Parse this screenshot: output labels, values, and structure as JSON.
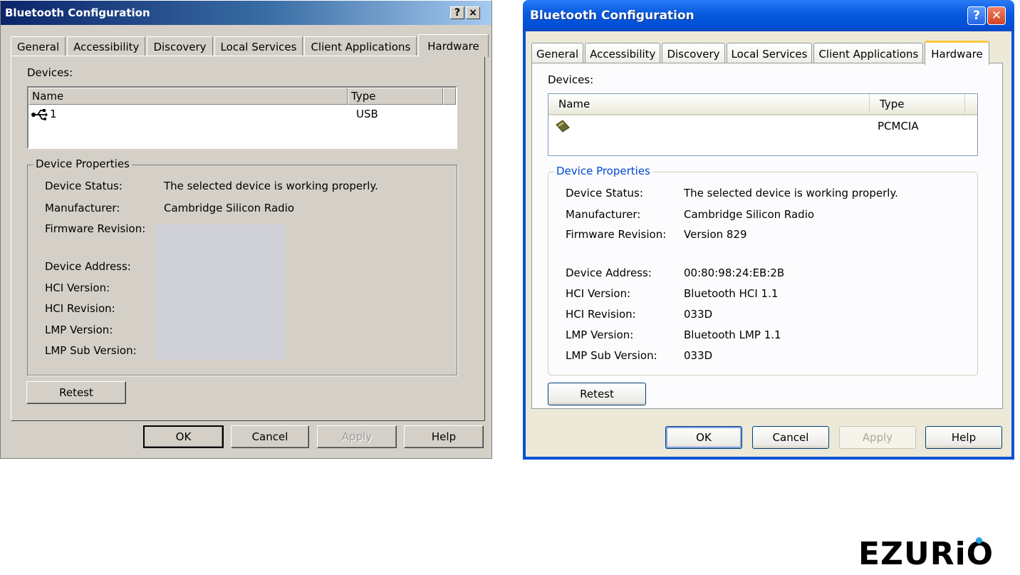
{
  "classic": {
    "title": "Bluetooth Configuration",
    "help_glyph": "?",
    "close_glyph": "×",
    "tabs": [
      {
        "label": "General"
      },
      {
        "label": "Accessibility"
      },
      {
        "label": "Discovery"
      },
      {
        "label": "Local Services"
      },
      {
        "label": "Client Applications"
      },
      {
        "label": "Hardware",
        "active": true
      }
    ],
    "devices_label": "Devices:",
    "columns": {
      "name": "Name",
      "type": "Type"
    },
    "device": {
      "name": "1",
      "type": "USB",
      "icon": "usb-icon"
    },
    "group_title": "Device Properties",
    "properties": [
      {
        "label": "Device Status:",
        "value": "The selected device is working properly."
      },
      {
        "label": "Manufacturer:",
        "value": "Cambridge Silicon Radio"
      },
      {
        "label": "Firmware Revision:",
        "value": ""
      },
      {
        "label": "Device Address:",
        "value": ""
      },
      {
        "label": "HCI Version:",
        "value": ""
      },
      {
        "label": "HCI Revision:",
        "value": ""
      },
      {
        "label": "LMP Version:",
        "value": ""
      },
      {
        "label": "LMP Sub Version:",
        "value": ""
      }
    ],
    "retest": "Retest",
    "buttons": {
      "ok": "OK",
      "cancel": "Cancel",
      "apply": "Apply",
      "help": "Help"
    }
  },
  "xp": {
    "title": "Bluetooth Configuration",
    "help_glyph": "?",
    "close_glyph": "✕",
    "tabs": [
      {
        "label": "General"
      },
      {
        "label": "Accessibility"
      },
      {
        "label": "Discovery"
      },
      {
        "label": "Local Services"
      },
      {
        "label": "Client Applications"
      },
      {
        "label": "Hardware",
        "active": true
      }
    ],
    "devices_label": "Devices:",
    "columns": {
      "name": "Name",
      "type": "Type"
    },
    "device": {
      "name": "",
      "type": "PCMCIA",
      "icon": "pcmcia-card-icon"
    },
    "group_title": "Device Properties",
    "properties": [
      {
        "label": "Device Status:",
        "value": "The selected device is working properly."
      },
      {
        "label": "Manufacturer:",
        "value": "Cambridge Silicon Radio"
      },
      {
        "label": "Firmware Revision:",
        "value": "Version 829"
      },
      {
        "label": "Device Address:",
        "value": "00:80:98:24:EB:2B"
      },
      {
        "label": "HCI Version:",
        "value": "Bluetooth HCI 1.1"
      },
      {
        "label": "HCI Revision:",
        "value": "033D"
      },
      {
        "label": "LMP Version:",
        "value": "Bluetooth LMP 1.1"
      },
      {
        "label": "LMP Sub Version:",
        "value": "033D"
      }
    ],
    "retest": "Retest",
    "buttons": {
      "ok": "OK",
      "cancel": "Cancel",
      "apply": "Apply",
      "help": "Help"
    }
  },
  "logo": {
    "text": "EZURiO",
    "accent": "#29a3e0"
  }
}
